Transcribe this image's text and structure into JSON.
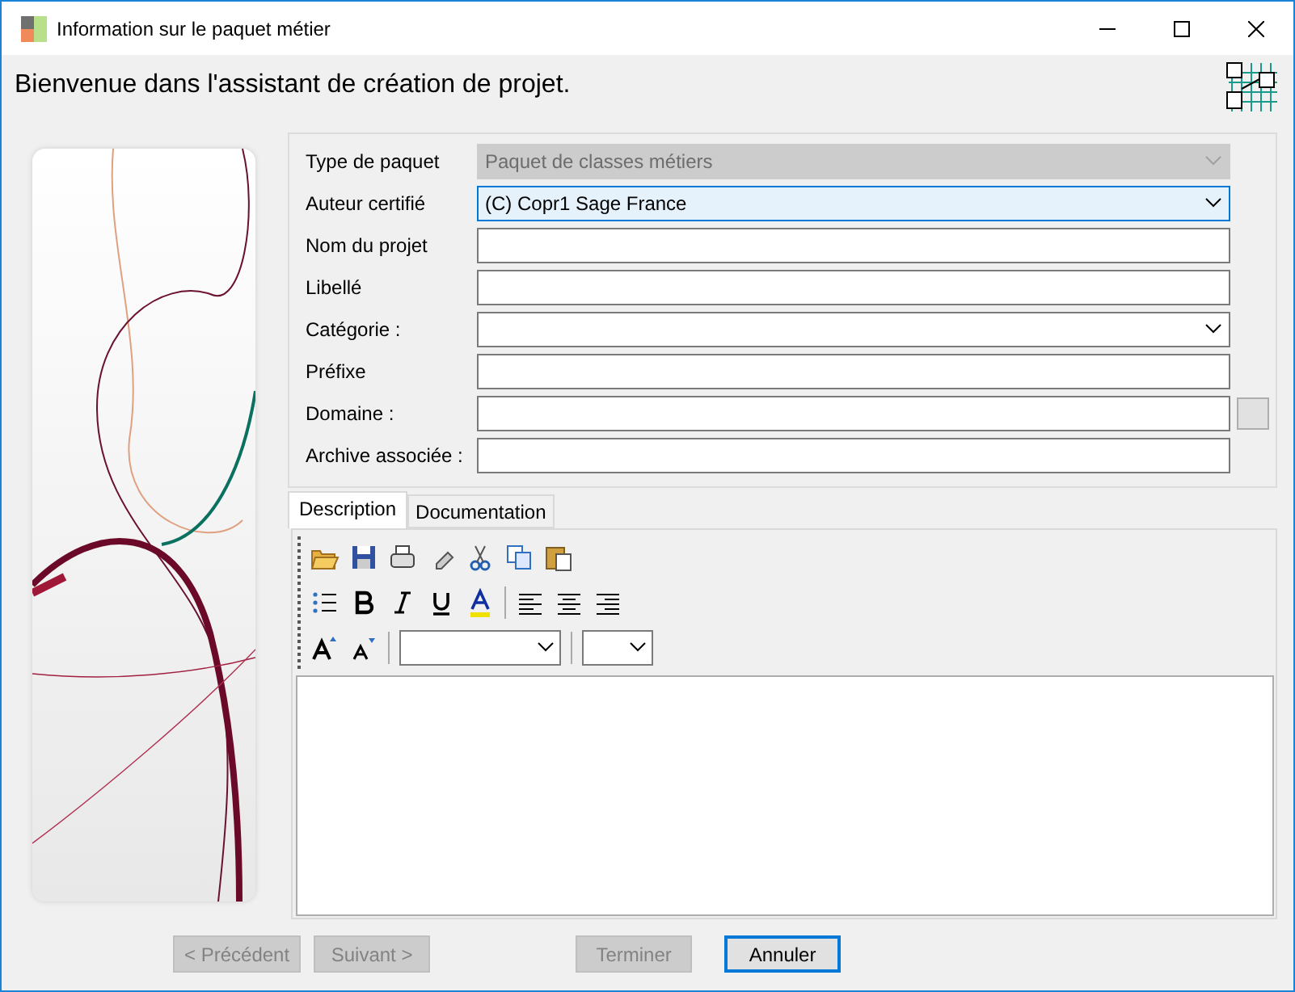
{
  "window": {
    "title": "Information sur le paquet métier"
  },
  "header": {
    "text": "Bienvenue dans l'assistant de création de projet."
  },
  "fields": [
    {
      "label": "Type de paquet",
      "kind": "combo",
      "value": "Paquet de classes métiers",
      "disabled": true,
      "focused": false
    },
    {
      "label": "Auteur certifié",
      "kind": "combo",
      "value": "(C) Copr1 Sage France",
      "disabled": false,
      "focused": true
    },
    {
      "label": "Nom du projet",
      "kind": "text",
      "disabled": false,
      "focused": false
    },
    {
      "label": "Libellé",
      "kind": "text",
      "disabled": false,
      "focused": false
    },
    {
      "label": "Catégorie :",
      "kind": "combo",
      "disabled": false,
      "focused": false
    },
    {
      "label": "Préfixe",
      "kind": "text",
      "disabled": false,
      "focused": false
    },
    {
      "label": "Domaine :",
      "kind": "browse",
      "disabled": false,
      "focused": false
    },
    {
      "label": "Archive associée :",
      "kind": "text",
      "disabled": false,
      "focused": false
    }
  ],
  "tabs": [
    {
      "label": "Description",
      "selected": true
    },
    {
      "label": "Documentation",
      "selected": false
    }
  ],
  "buttons": [
    {
      "label": "< Précédent",
      "disabled": true,
      "default": false
    },
    {
      "label": "Suivant >",
      "disabled": true,
      "default": false
    },
    {
      "label": "Terminer",
      "disabled": true,
      "default": false
    },
    {
      "label": "Annuler",
      "disabled": false,
      "default": true
    }
  ]
}
